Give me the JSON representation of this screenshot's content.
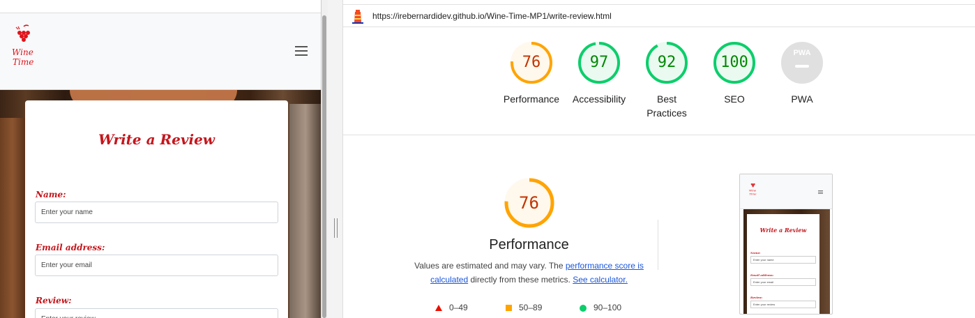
{
  "preview": {
    "review_title": "Write a Review",
    "fields": [
      {
        "label": "Name:",
        "placeholder": "Enter your name"
      },
      {
        "label": "Email address:",
        "placeholder": "Enter your email"
      },
      {
        "label": "Review:",
        "placeholder": "Enter your review"
      }
    ],
    "logo_text": "Wine Time"
  },
  "report": {
    "url": "https://irebernardidev.github.io/Wine-Time-MP1/write-review.html",
    "categories": [
      {
        "label": "Performance",
        "score": "76",
        "level": 0.76,
        "color": "#ffa400",
        "text_color": "#c33300",
        "fill": "#fff8ec"
      },
      {
        "label": "Accessibility",
        "score": "97",
        "level": 0.97,
        "color": "#0cce6b",
        "text_color": "#008800",
        "fill": "#eafaf1"
      },
      {
        "label": "Best Practices",
        "score": "92",
        "level": 0.92,
        "color": "#0cce6b",
        "text_color": "#008800",
        "fill": "#eafaf1"
      },
      {
        "label": "SEO",
        "score": "100",
        "level": 1.0,
        "color": "#0cce6b",
        "text_color": "#008800",
        "fill": "#eafaf1"
      },
      {
        "label": "PWA",
        "score": "PWA",
        "level": 0,
        "color": "#e0e0e0",
        "text_color": "#ffffff",
        "fill": "#e0e0e0"
      }
    ],
    "performance": {
      "score": "76",
      "title": "Performance",
      "desc_before": "Values are estimated and may vary. The ",
      "link1": "performance score is calculated",
      "desc_middle": " directly from these metrics. ",
      "link2": "See calculator."
    },
    "legend": [
      {
        "range": "0–49",
        "shape": "triangle",
        "color": "#eb0f00"
      },
      {
        "range": "50–89",
        "shape": "square",
        "color": "#ffa400"
      },
      {
        "range": "90–100",
        "shape": "circle",
        "color": "#0cce6b"
      }
    ],
    "thumbnail": {
      "title": "Write a Review",
      "labels": [
        "Name:",
        "Email address:",
        "Review:"
      ],
      "placeholders": [
        "Enter your name",
        "Enter your email",
        "Enter your review"
      ]
    }
  }
}
